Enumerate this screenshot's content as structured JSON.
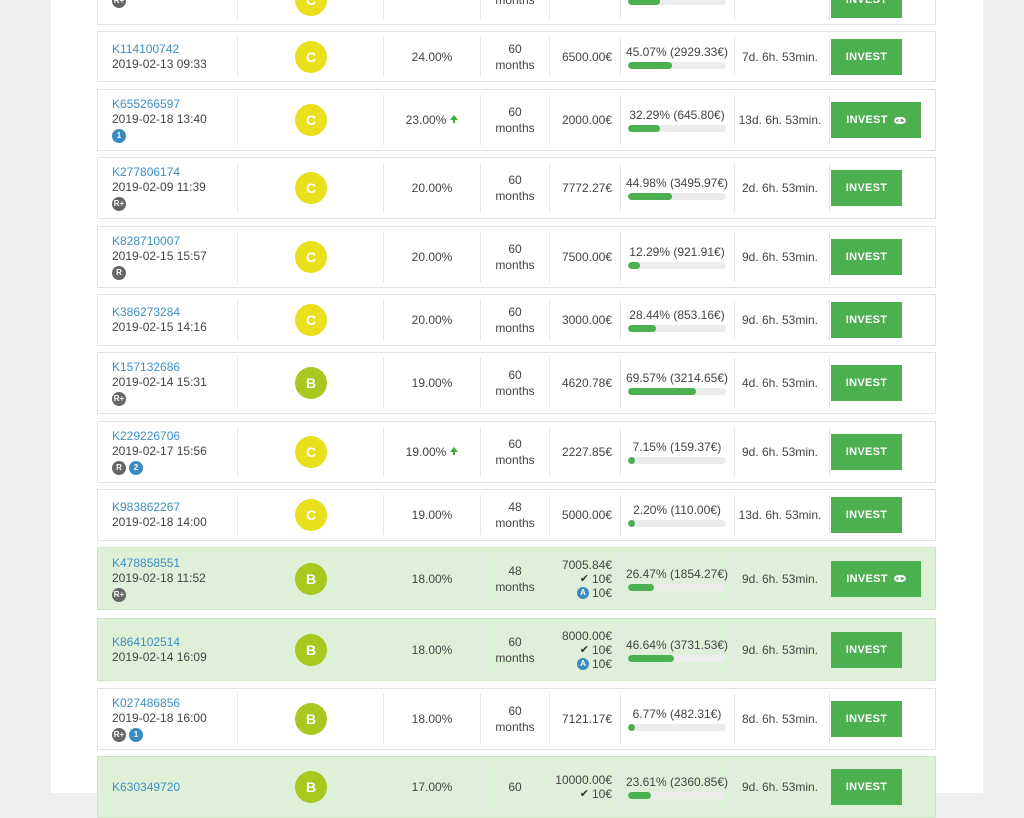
{
  "loans": [
    {
      "id": "",
      "date": "",
      "badges": [
        {
          "text": "R+",
          "color": "dark"
        }
      ],
      "rating": "C",
      "rate": "",
      "term_value": "",
      "term_unit": "months",
      "amount": "",
      "progress_text": "",
      "progress": 0.33,
      "time": "",
      "button": "INVEST",
      "eye": false,
      "highlight": false
    },
    {
      "id": "K114100742",
      "date": "2019-02-13 09:33",
      "badges": [],
      "rating": "C",
      "rate": "24.00%",
      "term_value": "60",
      "term_unit": "months",
      "amount": "6500.00€",
      "progress_text": "45.07% (2929.33€)",
      "progress": 0.4507,
      "time": "7d. 6h. 53min.",
      "button": "INVEST",
      "eye": false,
      "highlight": false
    },
    {
      "id": "K655266597",
      "date": "2019-02-18 13:40",
      "badges": [
        {
          "text": "1",
          "color": "blue"
        }
      ],
      "rating": "C",
      "rate": "23.00%",
      "rate_up": true,
      "term_value": "60",
      "term_unit": "months",
      "amount": "2000.00€",
      "progress_text": "32.29% (645.80€)",
      "progress": 0.3229,
      "time": "13d. 6h. 53min.",
      "button": "INVEST",
      "eye": true,
      "highlight": false
    },
    {
      "id": "K277806174",
      "date": "2019-02-09 11:39",
      "badges": [
        {
          "text": "R+",
          "color": "dark"
        }
      ],
      "rating": "C",
      "rate": "20.00%",
      "term_value": "60",
      "term_unit": "months",
      "amount": "7772.27€",
      "progress_text": "44.98% (3495.97€)",
      "progress": 0.4498,
      "time": "2d. 6h. 53min.",
      "button": "INVEST",
      "eye": false,
      "highlight": false
    },
    {
      "id": "K828710007",
      "date": "2019-02-15 15:57",
      "badges": [
        {
          "text": "R",
          "color": "dark"
        }
      ],
      "rating": "C",
      "rate": "20.00%",
      "term_value": "60",
      "term_unit": "months",
      "amount": "7500.00€",
      "progress_text": "12.29% (921.91€)",
      "progress": 0.1229,
      "time": "9d. 6h. 53min.",
      "button": "INVEST",
      "eye": false,
      "highlight": false
    },
    {
      "id": "K386273284",
      "date": "2019-02-15 14:16",
      "badges": [],
      "rating": "C",
      "rate": "20.00%",
      "term_value": "60",
      "term_unit": "months",
      "amount": "3000.00€",
      "progress_text": "28.44% (853.16€)",
      "progress": 0.2844,
      "time": "9d. 6h. 53min.",
      "button": "INVEST",
      "eye": false,
      "highlight": false
    },
    {
      "id": "K157132686",
      "date": "2019-02-14 15:31",
      "badges": [
        {
          "text": "R+",
          "color": "dark"
        }
      ],
      "rating": "B",
      "rate": "19.00%",
      "term_value": "60",
      "term_unit": "months",
      "amount": "4620.78€",
      "progress_text": "69.57% (3214.65€)",
      "progress": 0.6957,
      "time": "4d. 6h. 53min.",
      "button": "INVEST",
      "eye": false,
      "highlight": false
    },
    {
      "id": "K229226706",
      "date": "2019-02-17 15:56",
      "badges": [
        {
          "text": "R",
          "color": "dark"
        },
        {
          "text": "2",
          "color": "blue"
        }
      ],
      "rating": "C",
      "rate": "19.00%",
      "rate_up": true,
      "term_value": "60",
      "term_unit": "months",
      "amount": "2227.85€",
      "progress_text": "7.15% (159.37€)",
      "progress": 0.0715,
      "time": "9d. 6h. 53min.",
      "button": "INVEST",
      "eye": false,
      "highlight": false
    },
    {
      "id": "K983862267",
      "date": "2019-02-18 14:00",
      "badges": [],
      "rating": "C",
      "rate": "19.00%",
      "term_value": "48",
      "term_unit": "months",
      "amount": "5000.00€",
      "progress_text": "2.20% (110.00€)",
      "progress": 0.022,
      "time": "13d. 6h. 53min.",
      "button": "INVEST",
      "eye": false,
      "highlight": false
    },
    {
      "id": "K478858551",
      "date": "2019-02-18 11:52",
      "badges": [
        {
          "text": "R+",
          "color": "dark"
        }
      ],
      "rating": "B",
      "rate": "18.00%",
      "term_value": "48",
      "term_unit": "months",
      "amount": "7005.84€",
      "amount_check": "10€",
      "amount_auto": "10€",
      "progress_text": "26.47% (1854.27€)",
      "progress": 0.2647,
      "time": "9d. 6h. 53min.",
      "button": "INVEST",
      "eye": true,
      "highlight": true
    },
    {
      "id": "K864102514",
      "date": "2019-02-14 16:09",
      "badges": [],
      "rating": "B",
      "rate": "18.00%",
      "term_value": "60",
      "term_unit": "months",
      "amount": "8000.00€",
      "amount_check": "10€",
      "amount_auto": "10€",
      "progress_text": "46.64% (3731.53€)",
      "progress": 0.4664,
      "time": "9d. 6h. 53min.",
      "button": "INVEST",
      "eye": false,
      "highlight": true
    },
    {
      "id": "K027486856",
      "date": "2019-02-18 16:00",
      "badges": [
        {
          "text": "R+",
          "color": "dark"
        },
        {
          "text": "1",
          "color": "blue"
        }
      ],
      "rating": "B",
      "rate": "18.00%",
      "term_value": "60",
      "term_unit": "months",
      "amount": "7121.17€",
      "progress_text": "6.77% (482.31€)",
      "progress": 0.0677,
      "time": "8d. 6h. 53min.",
      "button": "INVEST",
      "eye": false,
      "highlight": false
    },
    {
      "id": "K630349720",
      "date": "",
      "badges": [],
      "rating": "B",
      "rate": "17.00%",
      "term_value": "60",
      "term_unit": "",
      "amount": "10000.00€",
      "amount_check": "10€",
      "progress_text": "23.61% (2360.85€)",
      "progress": 0.2361,
      "time": "9d. 6h. 53min.",
      "button": "INVEST",
      "eye": false,
      "highlight": true
    }
  ],
  "colors": {
    "accent_green": "#4caf50",
    "link_blue": "#3d8fc4",
    "grade_c": "#e8df1d",
    "grade_b": "#a9c81f",
    "highlight_row": "#dff0d8"
  }
}
